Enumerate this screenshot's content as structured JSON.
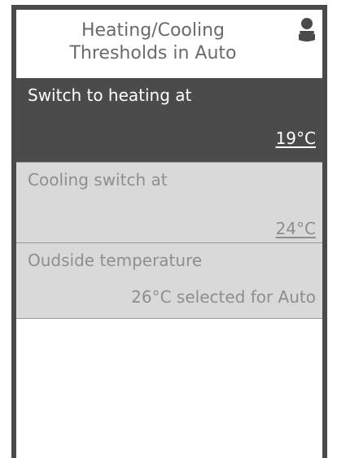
{
  "header": {
    "title": "Heating/Cooling\nThresholds in Auto",
    "user_icon": "user-icon"
  },
  "items": [
    {
      "label": "Switch to heating at",
      "value": "19°C",
      "selected": true
    },
    {
      "label": "Cooling switch at",
      "value": "24°C",
      "selected": false
    },
    {
      "label": "Oudside temperature",
      "value": "26°C selected for Auto",
      "selected": false
    }
  ],
  "colors": {
    "frame": "#4a4a4a",
    "selected_row_bg": "#4b4b4b",
    "row_bg": "#d9d9d9",
    "muted_text": "#8e8e8e",
    "title_text": "#6a6a6a"
  }
}
